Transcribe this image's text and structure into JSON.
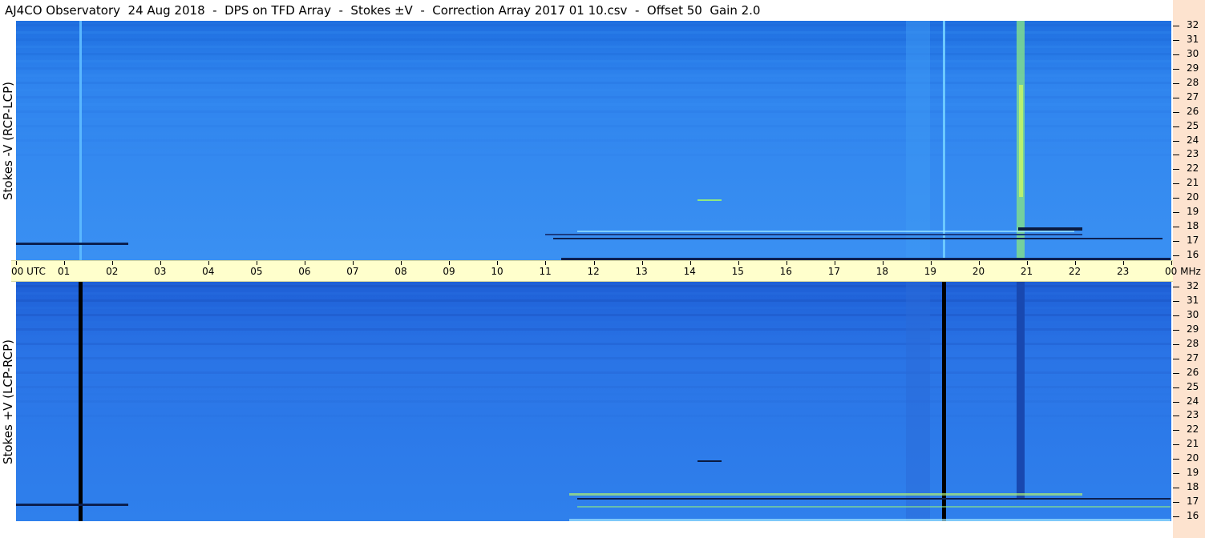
{
  "title": "AJ4CO Observatory  24 Aug 2018  -  DPS on TFD Array  -  Stokes ±V  -  Correction Array 2017 01 10.csv  -  Offset 50  Gain 2.0",
  "panels": {
    "top_label": "Stokes -V (RCP-LCP)",
    "bottom_label": "Stokes +V (LCP-RCP)"
  },
  "time_axis": {
    "labels": [
      "00 UTC",
      "01",
      "02",
      "03",
      "04",
      "05",
      "06",
      "07",
      "08",
      "09",
      "10",
      "11",
      "12",
      "13",
      "14",
      "15",
      "16",
      "17",
      "18",
      "19",
      "20",
      "21",
      "22",
      "23",
      "00 MHz"
    ]
  },
  "freq_axis": {
    "labels": [
      "32",
      "31",
      "30",
      "29",
      "28",
      "27",
      "26",
      "25",
      "24",
      "23",
      "22",
      "21",
      "20",
      "19",
      "18",
      "17",
      "16"
    ]
  },
  "chart_data": {
    "type": "heatmap",
    "title": "AJ4CO Observatory  24 Aug 2018  -  DPS on TFD Array  -  Stokes ±V  -  Correction Array 2017 01 10.csv  -  Offset 50  Gain 2.0",
    "panels": [
      "Stokes -V (RCP-LCP)",
      "Stokes +V (LCP-RCP)"
    ],
    "x_range_utc_hours": [
      0,
      24
    ],
    "y_range_mhz": [
      16,
      32
    ],
    "colors": {
      "background": "#2f86ee",
      "bright": "#aaf060",
      "dark": "#0a1a40"
    }
  }
}
